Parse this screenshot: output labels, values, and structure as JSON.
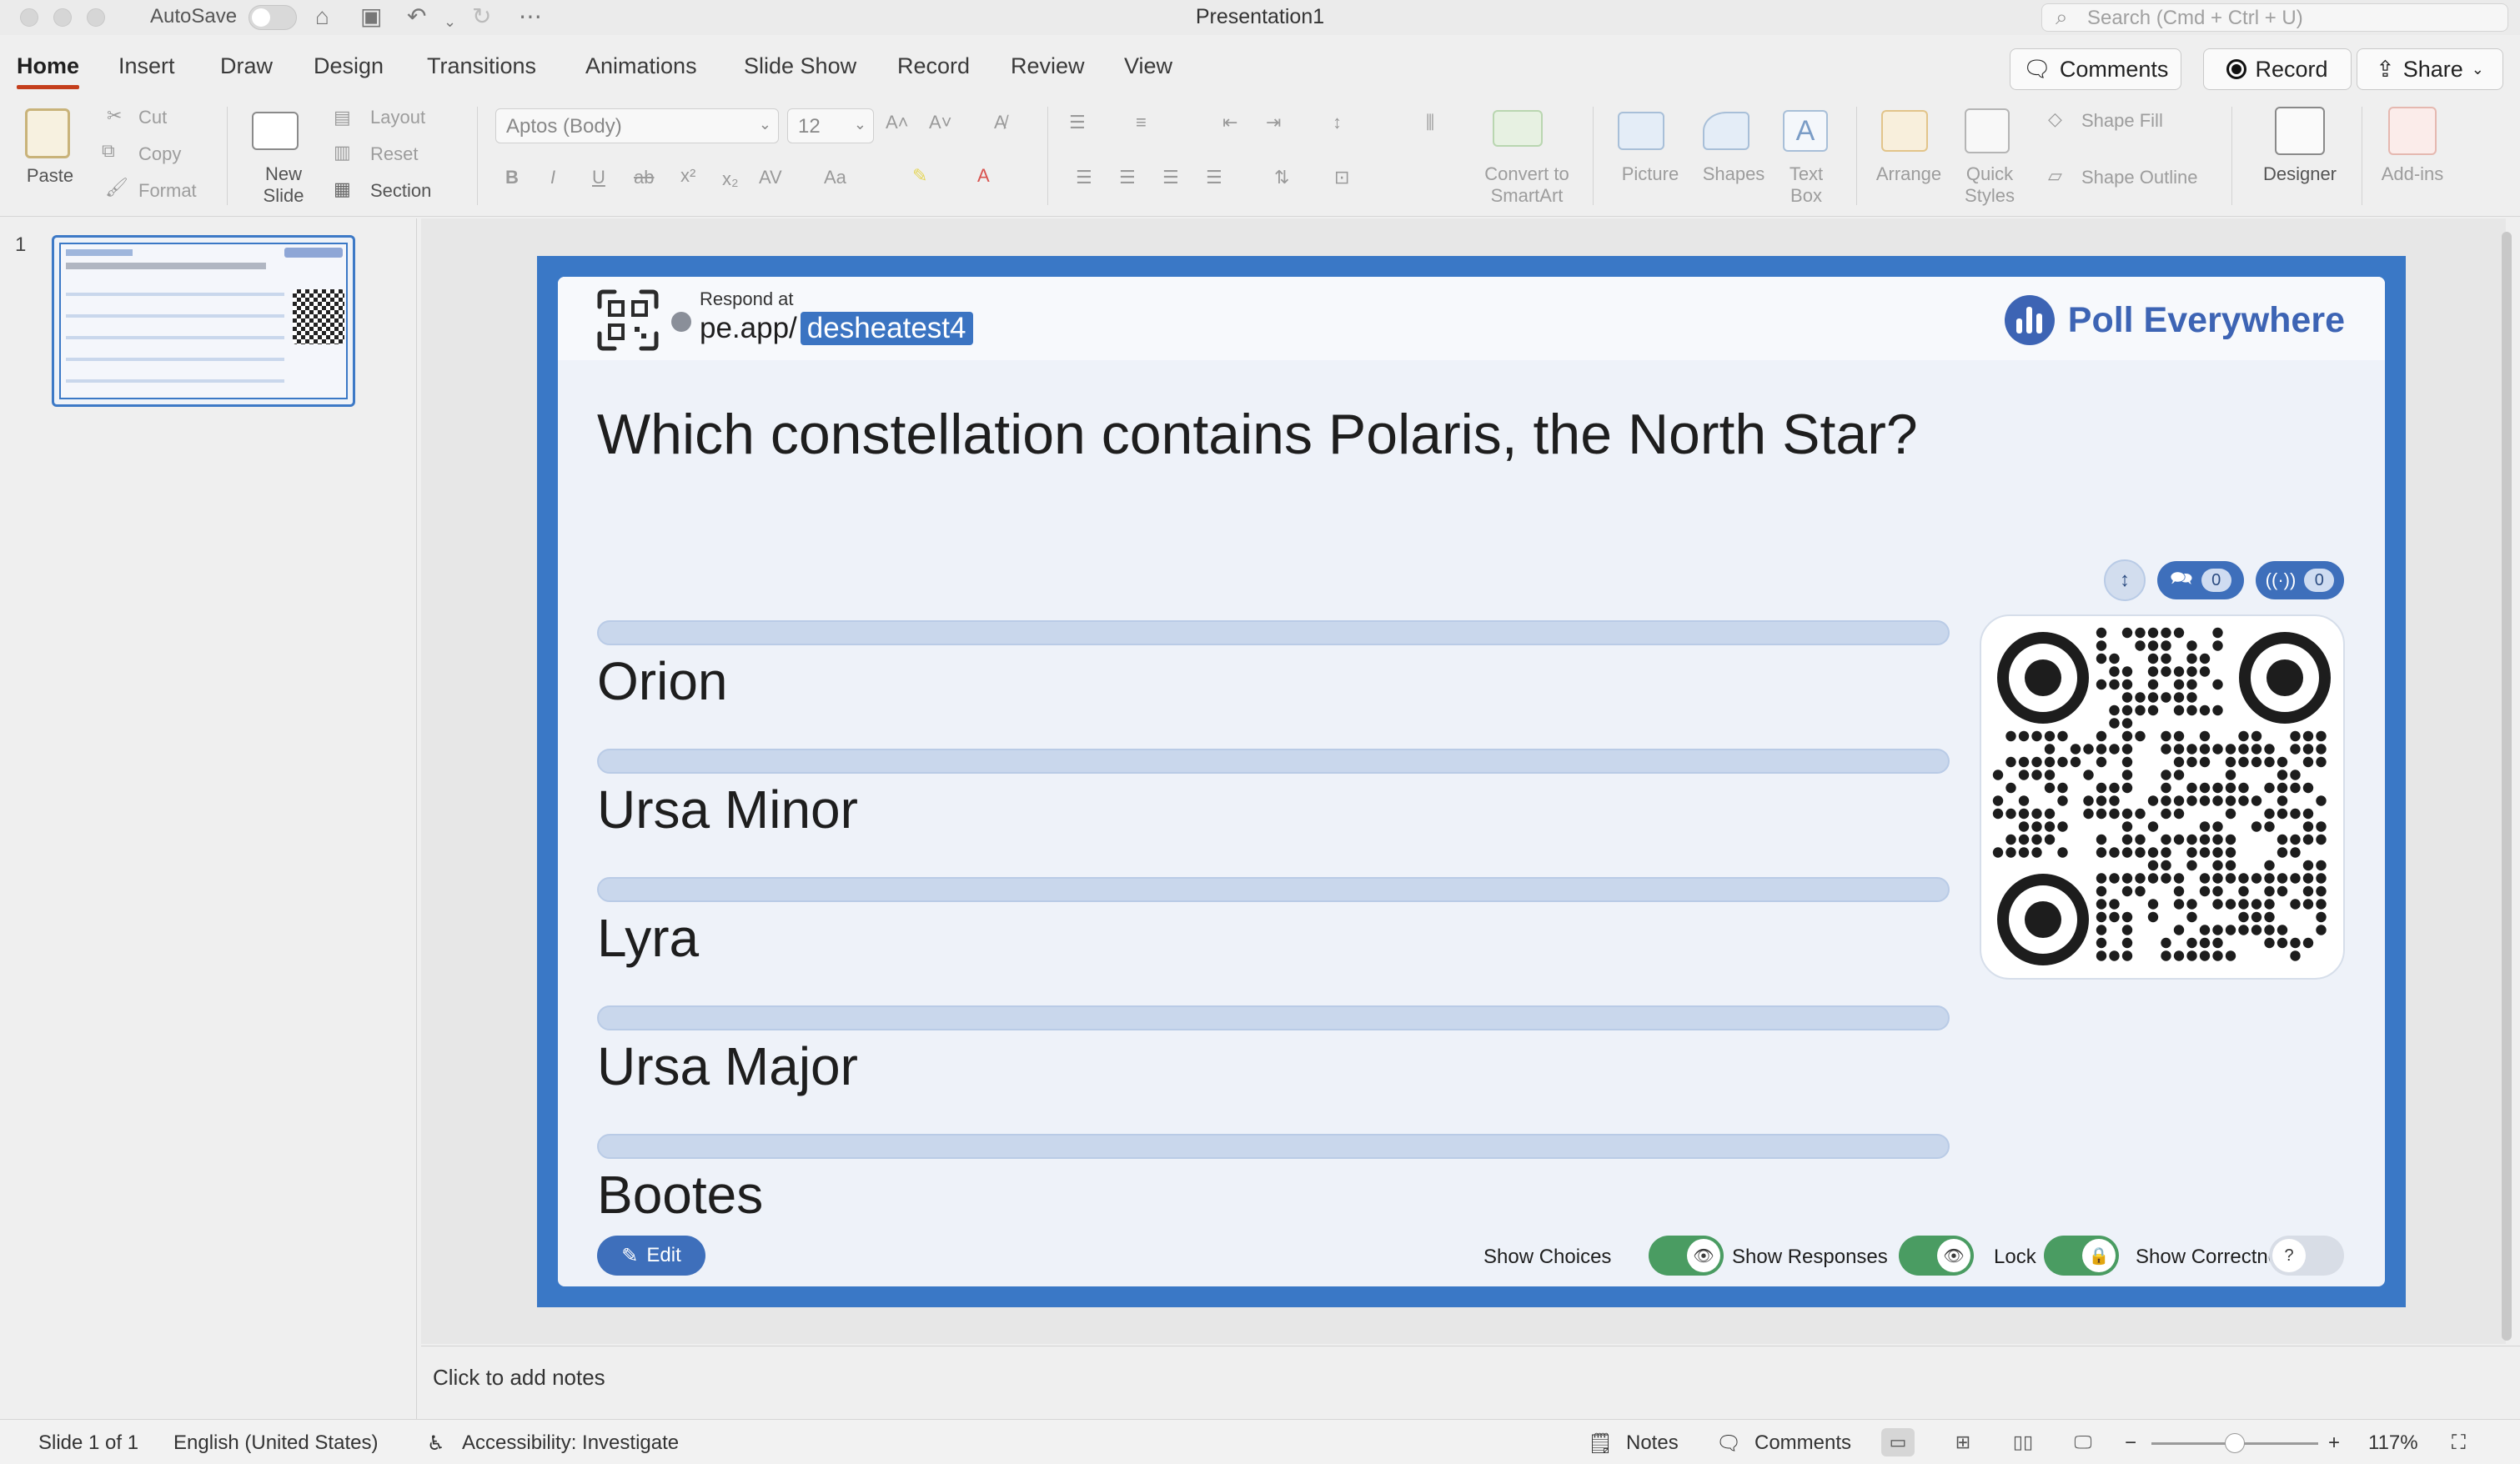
{
  "window": {
    "title": "Presentation1",
    "autosave_label": "AutoSave",
    "search_placeholder": "Search (Cmd + Ctrl + U)"
  },
  "ribbon_tabs": [
    "Home",
    "Insert",
    "Draw",
    "Design",
    "Transitions",
    "Animations",
    "Slide Show",
    "Record",
    "Review",
    "View"
  ],
  "active_tab": "Home",
  "top_buttons": {
    "comments": "Comments",
    "record": "Record",
    "share": "Share"
  },
  "ribbon": {
    "paste": "Paste",
    "cut": "Cut",
    "copy": "Copy",
    "format": "Format",
    "new_slide": "New Slide",
    "layout": "Layout",
    "reset": "Reset",
    "section": "Section",
    "font_name": "Aptos (Body)",
    "font_size": "12",
    "convert_smartart": "Convert to SmartArt",
    "picture": "Picture",
    "shapes": "Shapes",
    "text_box": "Text Box",
    "arrange": "Arrange",
    "quick_styles": "Quick Styles",
    "shape_fill": "Shape Fill",
    "shape_outline": "Shape Outline",
    "designer": "Designer",
    "add_ins": "Add-ins"
  },
  "thumbnail": {
    "number": "1"
  },
  "slide": {
    "respond_at": "Respond at",
    "url_prefix": "pe.app/",
    "url_code": "desheatest4",
    "brand": "Poll Everywhere",
    "question": "Which constellation contains Polaris, the North Star?",
    "choices": [
      "Orion",
      "Ursa Minor",
      "Lyra",
      "Ursa Major",
      "Bootes"
    ],
    "message_count": "0",
    "participant_count": "0",
    "edit_label": "Edit",
    "controls": {
      "show_choices": "Show Choices",
      "show_responses": "Show Responses",
      "lock": "Lock",
      "show_correctness": "Show Correctness"
    },
    "toggles": {
      "show_choices": true,
      "show_responses": true,
      "lock": true,
      "show_correctness": false
    }
  },
  "notes_placeholder": "Click to add notes",
  "status": {
    "slide_pos": "Slide 1 of 1",
    "language": "English (United States)",
    "accessibility": "Accessibility: Investigate",
    "notes": "Notes",
    "comments": "Comments",
    "zoom": "117%"
  },
  "colors": {
    "accent": "#c43e1c",
    "slide_frame": "#3a78c6",
    "poll_blue": "#3e6fbb",
    "toggle_on": "#4a9c62"
  }
}
